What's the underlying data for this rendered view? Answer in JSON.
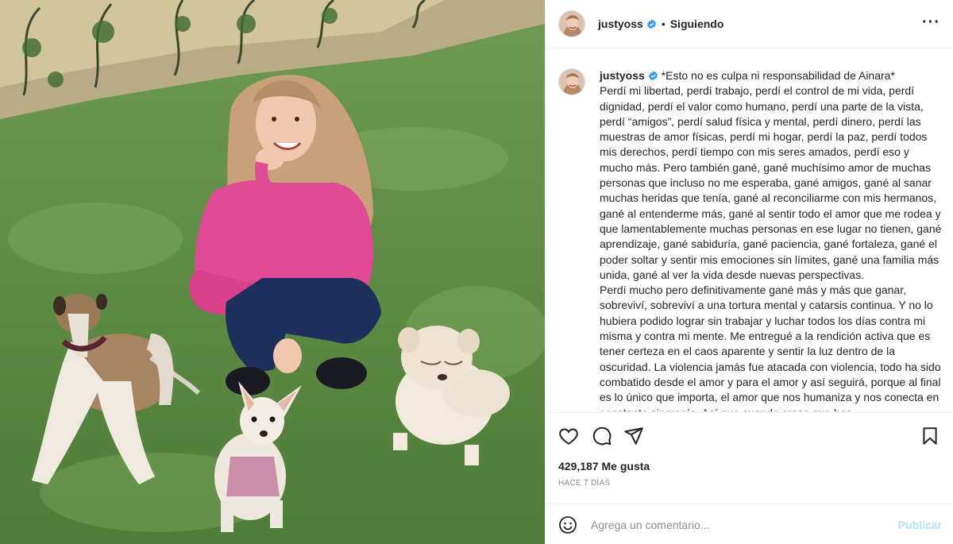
{
  "post": {
    "author": {
      "username": "justyoss",
      "verified": true,
      "follow_status": "Siguiendo"
    },
    "caption": {
      "username": "justyoss",
      "text": "*Esto no es culpa ni responsabilidad de Ainara*\nPerdí mi libertad, perdí trabajo, perdí el control de mi vida, perdí dignidad, perdí el valor como humano, perdí una parte de la vista, perdí “amigos”, perdí salud física y mental, perdí dinero, perdí las muestras de amor físicas, perdí mi hogar, perdí la paz, perdí todos mis derechos, perdí tiempo con mis seres amados, perdí eso y mucho más. Pero también gané, gané muchísimo amor de muchas personas que incluso no me esperaba, gané amigos, gané al sanar muchas heridas que tenía, gané al reconciliarme con mis hermanos, gané al entenderme más, gané al sentir todo el amor que me rodea y que lamentablemente muchas personas en ese lugar no tienen, gané aprendizaje, gané sabiduría, gané paciencia, gané fortaleza, gané el poder soltar y sentir mis emociones sin límites, gané una familia más unida, gané al ver la vida desde nuevas perspectivas.\nPerdí mucho pero definitivamente gané más y más que ganar, sobreviví, sobreviví a una tortura mental y catarsis continua. Y no lo hubiera podido lograr sin trabajar y luchar todos los días contra mi misma y contra mi mente. Me entregué a la rendición activa que es tener certeza en el caos aparente y sentir la luz dentro de la oscuridad. La violencia jamás fue atacada con violencia, todo ha sido combatido desde el amor y para el amor y así seguirá, porque al final es lo único que importa, el amor que nos humaniza y nos conecta en constante sincronía. Así que cuando creas que has"
    },
    "likes_text": "429,187 Me gusta",
    "time_text": "HACE 7 DÍAS"
  },
  "comment": {
    "placeholder": "Agrega un comentario...",
    "publish_label": "Publicar"
  },
  "icons": {
    "options": "more-options-icon",
    "like": "heart-icon",
    "comment": "comment-icon",
    "share": "share-icon",
    "save": "bookmark-icon",
    "emoji": "emoji-icon",
    "verified": "verified-badge-icon"
  },
  "colors": {
    "verified_blue": "#3897f0",
    "publish_disabled": "#b2dffc",
    "secondary_text": "#8e8e8e"
  }
}
